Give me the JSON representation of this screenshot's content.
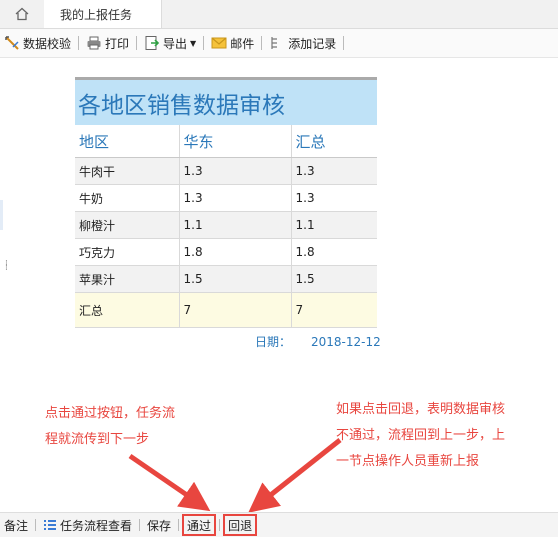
{
  "tabs": {
    "home_icon": "home-icon",
    "active_tab": "我的上报任务"
  },
  "toolbar": {
    "validate": "数据校验",
    "print": "打印",
    "export": "导出",
    "mail": "邮件",
    "add_record": "添加记录"
  },
  "report": {
    "title": "各地区销售数据审核",
    "columns": [
      "地区",
      "华东",
      "汇总"
    ],
    "rows": [
      [
        "牛肉干",
        "1.3",
        "1.3"
      ],
      [
        "牛奶",
        "1.3",
        "1.3"
      ],
      [
        "柳橙汁",
        "1.1",
        "1.1"
      ],
      [
        "巧克力",
        "1.8",
        "1.8"
      ],
      [
        "苹果汁",
        "1.5",
        "1.5"
      ]
    ],
    "total": [
      "汇总",
      "7",
      "7"
    ],
    "date_label": "日期：",
    "date_value": "2018-12-12"
  },
  "annotations": {
    "left_line1": "点击通过按钮，任务流",
    "left_line2": "程就流传到下一步",
    "right_line1": "如果点击回退，表明数据审核",
    "right_line2": "不通过，流程回到上一步，上",
    "right_line3": "一节点操作人员重新上报"
  },
  "bottombar": {
    "remark": "备注",
    "flow_view": "任务流程查看",
    "save": "保存",
    "pass": "通过",
    "back": "回退"
  },
  "colors": {
    "accent": "#2b78b9",
    "annotation": "#e8463f",
    "title_bg": "#bfe2f7"
  }
}
